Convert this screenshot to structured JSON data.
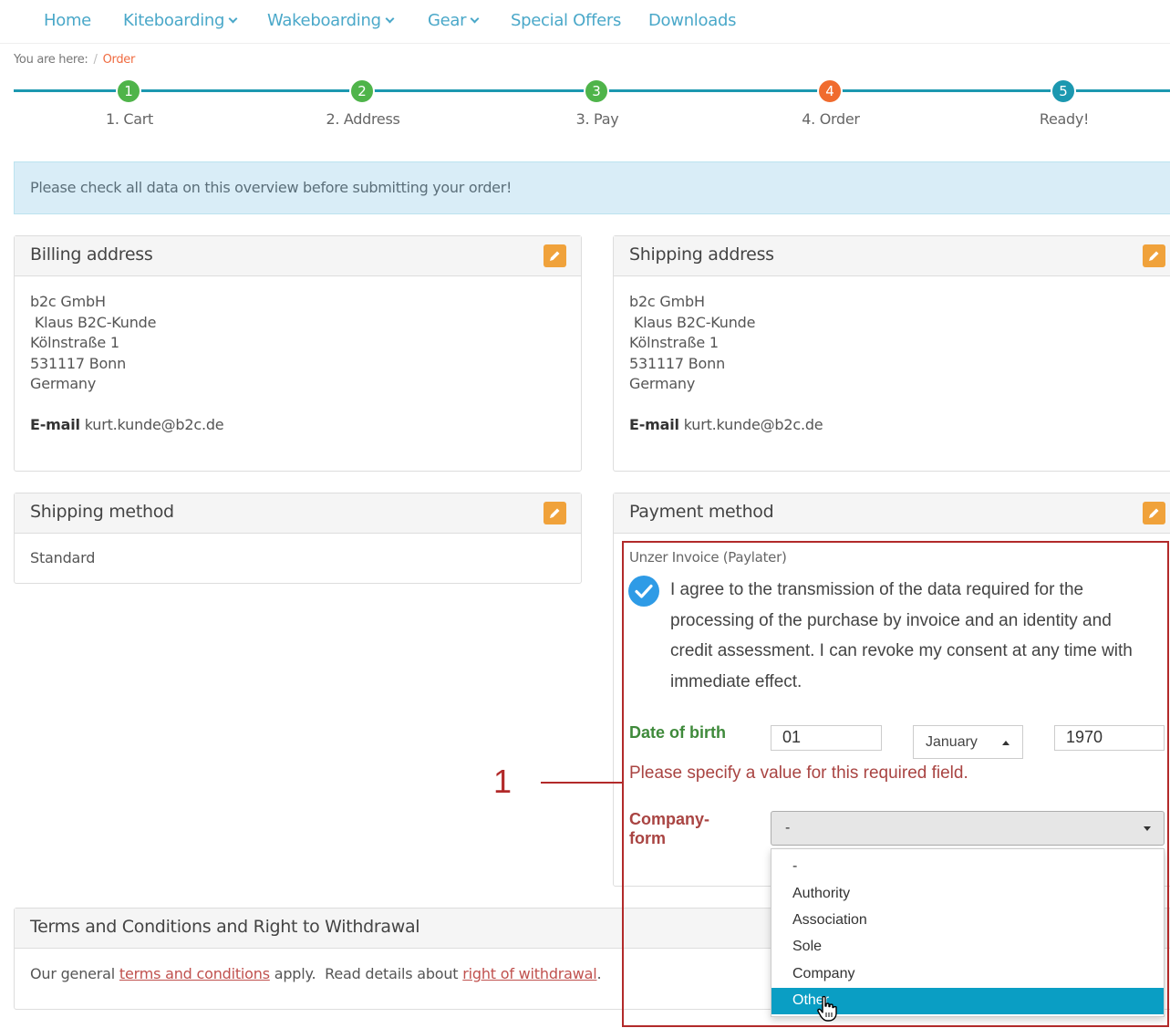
{
  "nav": {
    "items": [
      {
        "label": "Home",
        "has_dropdown": false
      },
      {
        "label": "Kiteboarding",
        "has_dropdown": true
      },
      {
        "label": "Wakeboarding",
        "has_dropdown": true
      },
      {
        "label": "Gear",
        "has_dropdown": true
      },
      {
        "label": "Special Offers",
        "has_dropdown": false
      },
      {
        "label": "Downloads",
        "has_dropdown": false
      }
    ]
  },
  "breadcrumb": {
    "prefix": "You are here:",
    "separator": "/",
    "current": "Order"
  },
  "steps": [
    {
      "number": "1",
      "label": "1. Cart",
      "state": "done"
    },
    {
      "number": "2",
      "label": "2. Address",
      "state": "done"
    },
    {
      "number": "3",
      "label": "3. Pay",
      "state": "done"
    },
    {
      "number": "4",
      "label": "4. Order",
      "state": "active"
    },
    {
      "number": "5",
      "label": "Ready!",
      "state": "next"
    }
  ],
  "alert": {
    "text": "Please check all data on this overview before submitting your order!"
  },
  "billing": {
    "title": "Billing address",
    "lines": [
      "b2c GmbH",
      " Klaus B2C-Kunde",
      "Kölnstraße 1",
      "531117 Bonn",
      "Germany"
    ],
    "email_label": "E-mail",
    "email": "kurt.kunde@b2c.de"
  },
  "shipping_address": {
    "title": "Shipping address",
    "lines": [
      "b2c GmbH",
      " Klaus B2C-Kunde",
      "Kölnstraße 1",
      "531117 Bonn",
      "Germany"
    ],
    "email_label": "E-mail",
    "email": "kurt.kunde@b2c.de"
  },
  "shipping_method": {
    "title": "Shipping method",
    "value": "Standard"
  },
  "payment": {
    "title": "Payment method",
    "method": "Unzer Invoice (Paylater)",
    "consent_checked": true,
    "consent_lines": [
      "I agree to the transmission of the data required for the",
      "processing of the purchase by invoice and an identity and",
      "credit assessment. I can revoke my consent at any time with",
      "immediate effect."
    ],
    "dob_label": "Date of birth",
    "dob_day": "01",
    "dob_month": "January",
    "dob_year": "1970",
    "error": "Please specify a value for this required field.",
    "company_label_1": "Company-",
    "company_label_2": "form",
    "company_value": "-",
    "company_options": [
      "-",
      "Authority",
      "Association",
      "Sole",
      "Company",
      "Other"
    ],
    "company_highlighted": "Other"
  },
  "terms": {
    "title": "Terms and Conditions and Right to Withdrawal",
    "text_1": "Our general ",
    "link_1": "terms and conditions",
    "text_2": " apply.  Read details about ",
    "link_2": "right of withdrawal",
    "text_3": "."
  },
  "annotation": {
    "number": "1"
  },
  "colors": {
    "nav_link": "#4aa8c9",
    "step_done": "#4fb44a",
    "step_active": "#f06b2e",
    "step_next": "#1c98b0",
    "edit": "#f0a23b",
    "error": "#a94442",
    "success": "#3f8a3b",
    "highlight": "#0a9ec4",
    "annotation": "#b22a2a"
  }
}
